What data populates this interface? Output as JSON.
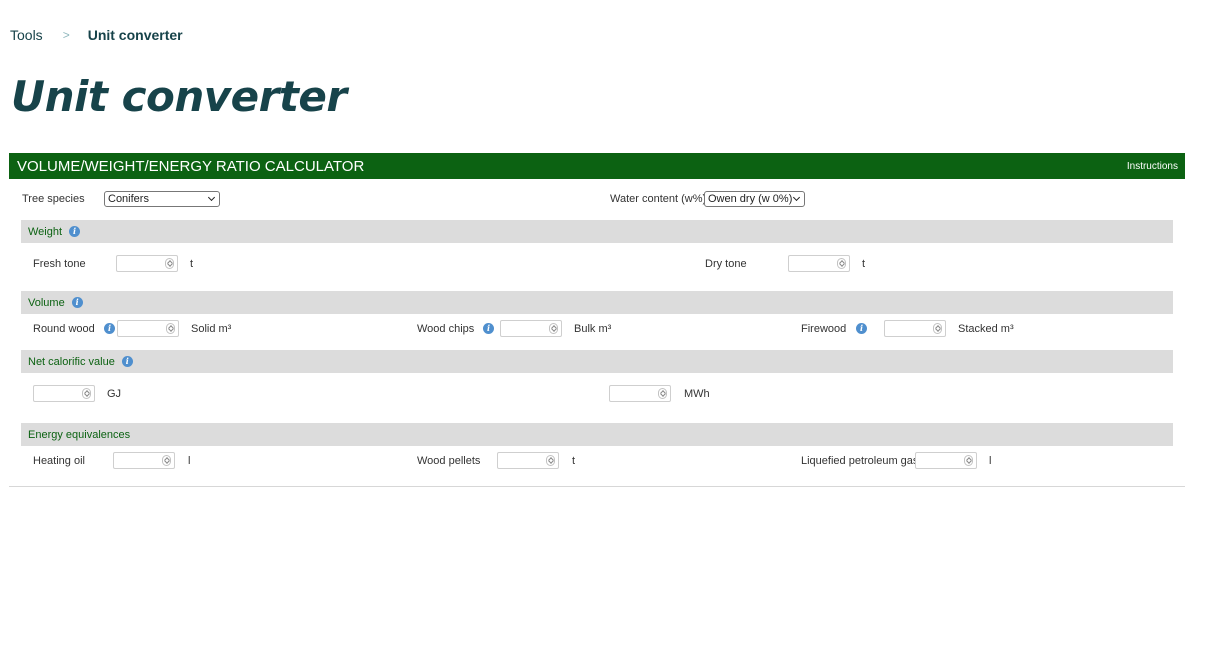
{
  "breadcrumb": {
    "items": [
      "Tools"
    ],
    "separator": ">",
    "current": "Unit converter"
  },
  "page_title": "Unit converter",
  "calculator": {
    "title": "VOLUME/WEIGHT/ENERGY RATIO CALCULATOR",
    "instructions_label": "Instructions",
    "tree_species": {
      "label": "Tree species",
      "value": "Conifers"
    },
    "water_content": {
      "label": "Water content (w%)",
      "value": "Owen dry (w 0%)"
    },
    "sections": {
      "weight": "Weight",
      "volume": "Volume",
      "calorific": "Net calorific value",
      "energy": "Energy equivalences"
    },
    "weight": {
      "fresh": {
        "label": "Fresh tone",
        "unit": "t"
      },
      "dry": {
        "label": "Dry tone",
        "unit": "t"
      }
    },
    "volume": {
      "round_wood": {
        "label": "Round wood",
        "unit": "Solid m³"
      },
      "wood_chips": {
        "label": "Wood chips",
        "unit": "Bulk m³"
      },
      "firewood": {
        "label": "Firewood",
        "unit": "Stacked m³"
      }
    },
    "calorific": {
      "gj": {
        "unit": "GJ"
      },
      "mwh": {
        "unit": "MWh"
      }
    },
    "energy": {
      "heating_oil": {
        "label": "Heating oil",
        "unit": "l"
      },
      "wood_pellets": {
        "label": "Wood pellets",
        "unit": "t"
      },
      "lpg": {
        "label": "Liquefied petroleum gas",
        "unit": "l"
      }
    }
  },
  "colors": {
    "header_green": "#0c6212",
    "title_teal": "#17434a",
    "section_gray": "#dcdcdc",
    "info_blue": "#4f8fce"
  },
  "icons": {
    "info": "info-icon",
    "spinner": "number-spinner-icon",
    "dropdown": "chevron-down-icon"
  }
}
